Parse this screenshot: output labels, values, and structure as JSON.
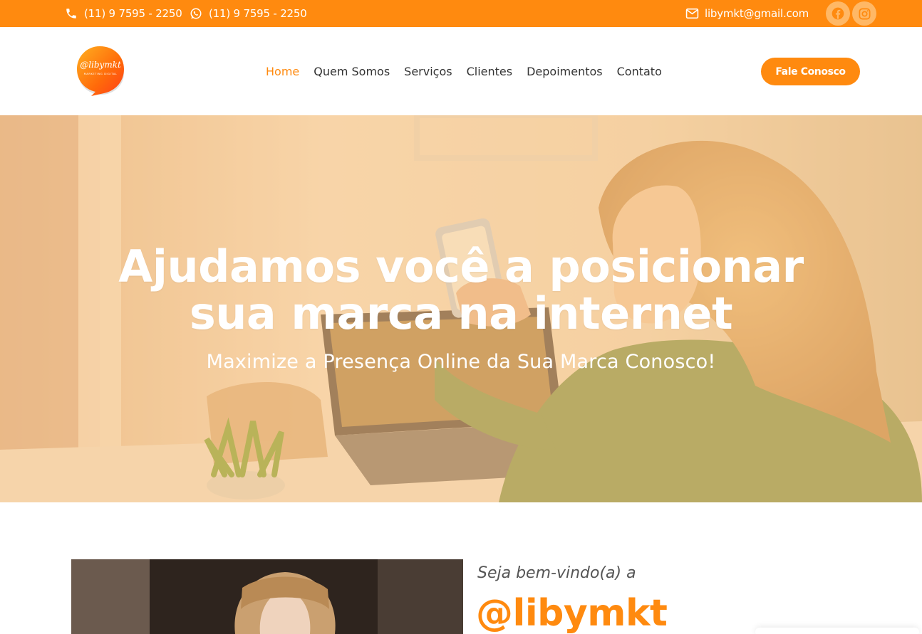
{
  "topbar": {
    "phone": "(11) 9 7595 - 2250",
    "whatsapp": "(11) 9 7595 - 2250",
    "email": "libymkt@gmail.com",
    "icons": [
      "phone-icon",
      "whatsapp-icon",
      "mail-icon",
      "facebook-icon",
      "instagram-icon"
    ]
  },
  "header": {
    "logo_text": "@libymkt",
    "logo_subtext": "MARKETING DIGITAL",
    "nav": [
      {
        "label": "Home",
        "active": true
      },
      {
        "label": "Quem Somos",
        "active": false
      },
      {
        "label": "Serviços",
        "active": false
      },
      {
        "label": "Clientes",
        "active": false
      },
      {
        "label": "Depoimentos",
        "active": false
      },
      {
        "label": "Contato",
        "active": false
      }
    ],
    "cta_label": "Fale Conosco"
  },
  "hero": {
    "title_line1": "Ajudamos você a posicionar",
    "title_line2": "sua marca na internet",
    "subtitle": "Maximize a Presença Online da Sua Marca Conosco!"
  },
  "about": {
    "welcome": "Seja bem-vindo(a) a",
    "brand": "@libymkt"
  },
  "colors": {
    "accent": "#ff8a0f",
    "white": "#ffffff",
    "text": "#333333"
  }
}
